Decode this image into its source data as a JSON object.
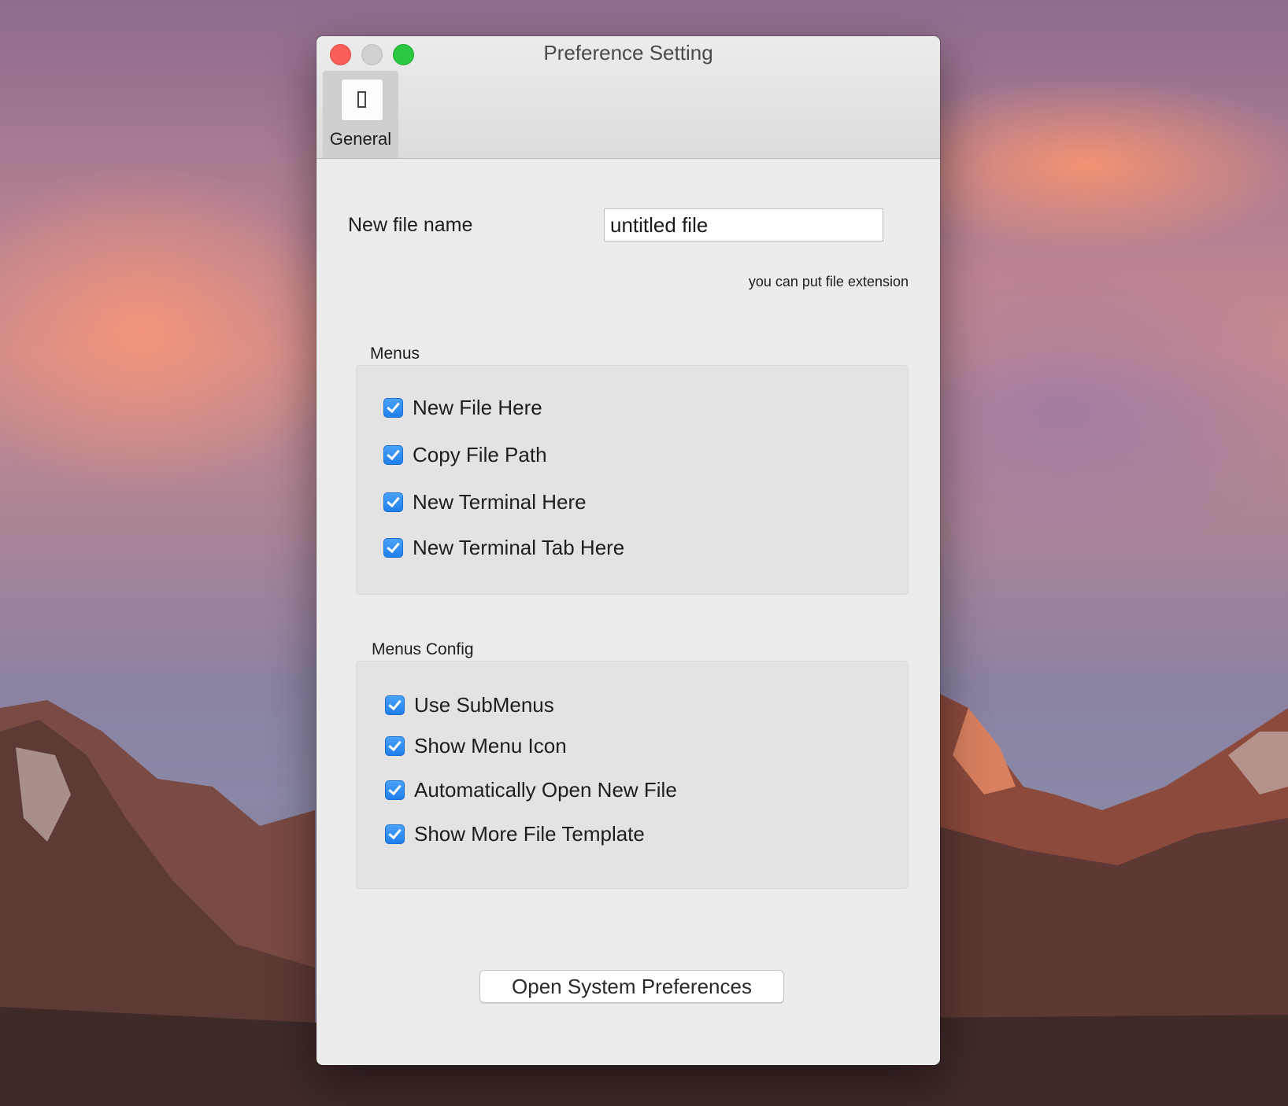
{
  "window": {
    "title": "Preference Setting"
  },
  "toolbar": {
    "tabs": [
      {
        "label": "General",
        "icon": "switch-icon"
      }
    ]
  },
  "general": {
    "file_name_label": "New file name",
    "file_name_value": "untitled file",
    "file_name_hint": "you can put file extension"
  },
  "menus": {
    "title": "Menus",
    "items": [
      {
        "label": "New File Here",
        "checked": true
      },
      {
        "label": "Copy File Path",
        "checked": true
      },
      {
        "label": "New Terminal Here",
        "checked": true
      },
      {
        "label": "New Terminal Tab Here",
        "checked": true
      }
    ]
  },
  "menus_config": {
    "title": "Menus Config",
    "items": [
      {
        "label": "Use SubMenus",
        "checked": true
      },
      {
        "label": "Show Menu Icon",
        "checked": true
      },
      {
        "label": "Automatically Open New File",
        "checked": true
      },
      {
        "label": "Show More File Template",
        "checked": true
      }
    ]
  },
  "footer": {
    "system_preferences_button": "Open System Preferences"
  },
  "colors": {
    "accent": "#2f8ef4",
    "window_bg": "#ececec",
    "close": "#fc5f57",
    "zoom": "#2ac840"
  }
}
